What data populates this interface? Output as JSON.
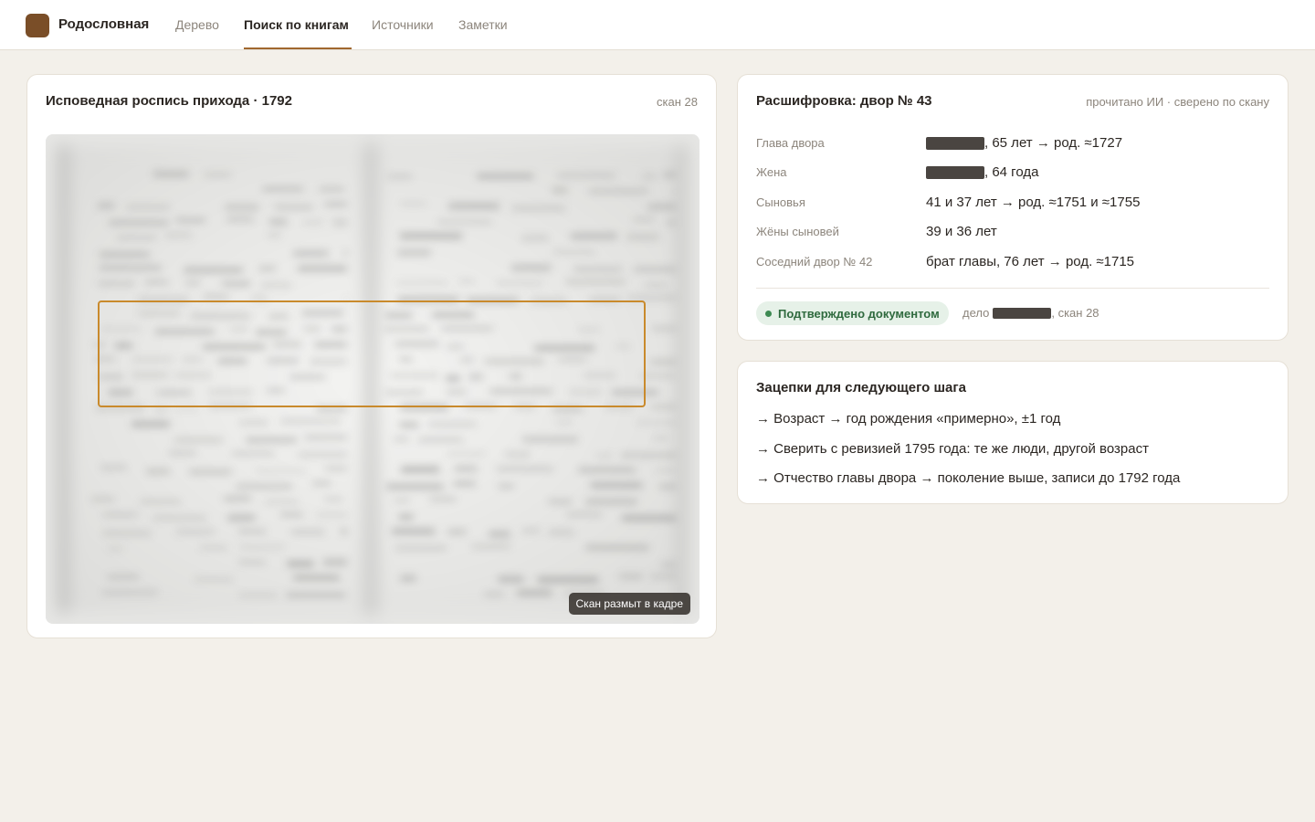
{
  "app": {
    "brand": "Родословная",
    "colors": {
      "accent": "#a0672f",
      "logo": "#7a4e28",
      "highlight": "#c98a2c",
      "confirmed": "#2f6a3e"
    }
  },
  "nav": {
    "tabs": [
      {
        "label": "Дерево",
        "active": false
      },
      {
        "label": "Поиск по книгам",
        "active": true
      },
      {
        "label": "Источники",
        "active": false
      },
      {
        "label": "Заметки",
        "active": false
      }
    ]
  },
  "document": {
    "title": "Исповедная роспись прихода · 1792",
    "scan_label": "скан 28",
    "caption": "Скан размыт в кадре"
  },
  "transcription": {
    "title": "Расшифровка: двор № 43",
    "meta": "прочитано ИИ · сверено по скану",
    "rows": [
      {
        "label": "Глава двора",
        "value": ", 65 лет → род. ≈1727",
        "redacted": true
      },
      {
        "label": "Жена",
        "value": ", 64 года",
        "redacted": true
      },
      {
        "label": "Сыновья",
        "value": "41 и 37 лет → род. ≈1751 и ≈1755",
        "redacted": false
      },
      {
        "label": "Жёны сыновей",
        "value": "39 и 36 лет",
        "redacted": false
      },
      {
        "label": "Соседний двор № 42",
        "value": "брат главы, 76 лет → род. ≈1715",
        "redacted": false
      }
    ],
    "badge": "Подтверждено документом",
    "case_prefix": "дело",
    "case_suffix": ", скан 28"
  },
  "hints": {
    "title": "Зацепки для следующего шага",
    "items": [
      "→ Возраст → год рождения «примерно», ±1 год",
      "→ Сверить с ревизией 1795 года: те же люди, другой возраст",
      "→ Отчество главы двора → поколение выше, записи до 1792 года"
    ]
  }
}
